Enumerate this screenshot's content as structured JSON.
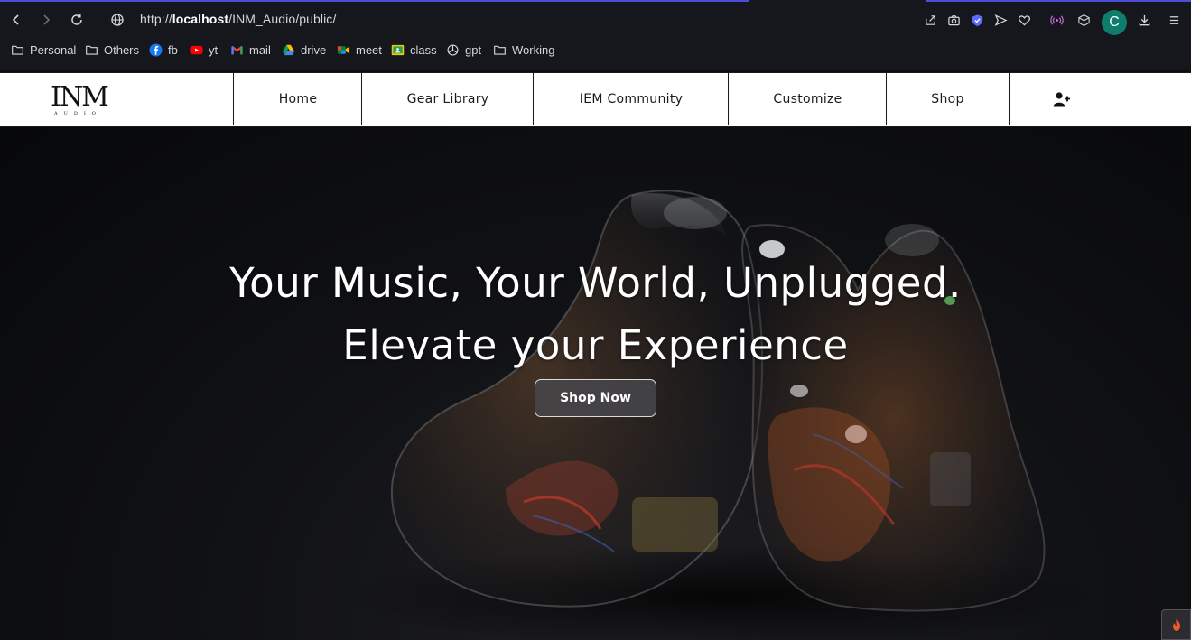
{
  "browser": {
    "url_prefix": "http://",
    "url_host": "localhost",
    "url_path": "/INM_Audio/public/",
    "profile_initial": "C",
    "colors": {
      "accent": "#4b4ddc",
      "avatar": "#0e7d6d",
      "shield": "#5b6bff"
    }
  },
  "bookmarks": [
    {
      "label": "Personal",
      "icon": "folder-icon"
    },
    {
      "label": "Others",
      "icon": "folder-icon"
    },
    {
      "label": "fb",
      "icon": "facebook-icon"
    },
    {
      "label": "yt",
      "icon": "youtube-icon"
    },
    {
      "label": "mail",
      "icon": "gmail-icon"
    },
    {
      "label": "drive",
      "icon": "drive-icon"
    },
    {
      "label": "meet",
      "icon": "meet-icon"
    },
    {
      "label": "class",
      "icon": "classroom-icon"
    },
    {
      "label": "gpt",
      "icon": "openai-icon"
    },
    {
      "label": "Working",
      "icon": "folder-icon"
    }
  ],
  "site": {
    "logo_text": "INM",
    "logo_sub": "AUDIO",
    "nav": [
      {
        "label": "Home"
      },
      {
        "label": "Gear Library"
      },
      {
        "label": "IEM Community"
      },
      {
        "label": "Customize"
      },
      {
        "label": "Shop"
      }
    ],
    "account_icon": "user-plus-icon"
  },
  "hero": {
    "line1": "Your Music, Your World, Unplugged.",
    "line2": "Elevate your Experience",
    "cta_label": "Shop Now"
  }
}
